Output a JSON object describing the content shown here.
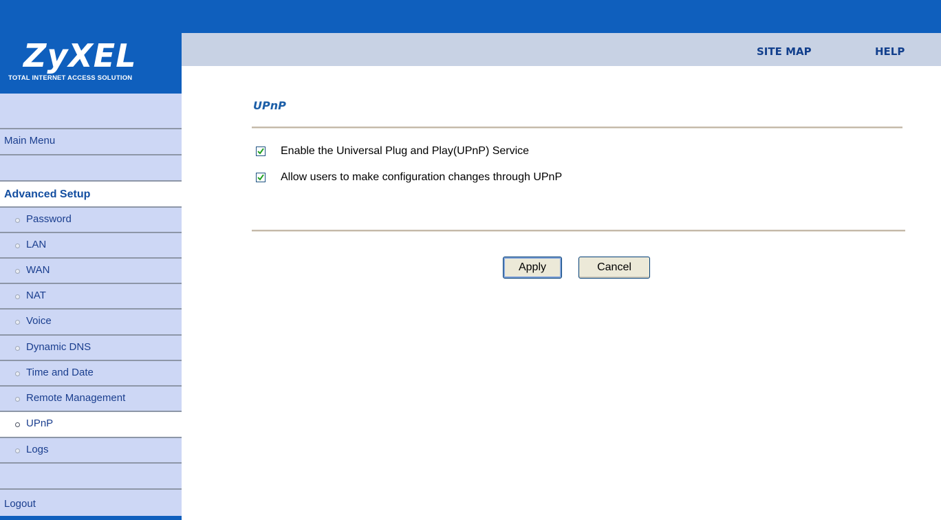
{
  "brand": {
    "logo_text": "ZyXEL",
    "tagline": "TOTAL INTERNET ACCESS SOLUTION"
  },
  "header": {
    "site_map": "SITE MAP",
    "help": "HELP"
  },
  "sidebar": {
    "main_menu": "Main Menu",
    "section_title": "Advanced Setup",
    "items": [
      {
        "label": "Password"
      },
      {
        "label": "LAN"
      },
      {
        "label": "WAN"
      },
      {
        "label": "NAT"
      },
      {
        "label": "Voice"
      },
      {
        "label": "Dynamic DNS"
      },
      {
        "label": "Time and Date"
      },
      {
        "label": "Remote Management"
      },
      {
        "label": "UPnP",
        "active": true
      },
      {
        "label": "Logs"
      }
    ],
    "logout": "Logout"
  },
  "page": {
    "title": "UPnP",
    "options": [
      {
        "label": "Enable the Universal Plug and Play(UPnP) Service",
        "checked": true
      },
      {
        "label": "Allow users to make configuration changes through UPnP",
        "checked": true
      }
    ],
    "apply_label": "Apply",
    "cancel_label": "Cancel"
  },
  "colors": {
    "brand_blue": "#0f5fbd",
    "nav_bg": "#cdd7f5",
    "title_blue": "#1b5ea7"
  }
}
